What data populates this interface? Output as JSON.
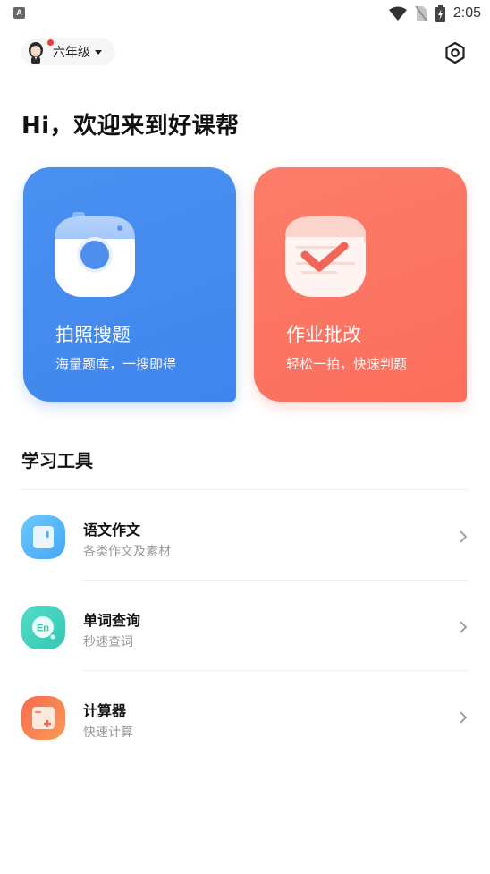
{
  "status_bar": {
    "left_icon": "A",
    "icons": [
      "wifi-icon",
      "no-sim-icon",
      "battery-charging-icon"
    ],
    "time": "2:05"
  },
  "header": {
    "grade": "六年级",
    "has_notification": true,
    "settings_icon": "settings-hexagon-icon"
  },
  "welcome": "Hi，欢迎来到好课帮",
  "features": [
    {
      "title": "拍照搜题",
      "subtitle": "海量题库，一搜即得",
      "icon": "camera-icon",
      "color": "#4388EF"
    },
    {
      "title": "作业批改",
      "subtitle": "轻松一拍，快速判题",
      "icon": "homework-check-icon",
      "color": "#FD725F"
    }
  ],
  "tools": {
    "title": "学习工具",
    "items": [
      {
        "title": "语文作文",
        "subtitle": "各类作文及素材",
        "icon": "notebook-icon",
        "color": "#56B6FA"
      },
      {
        "title": "单词查询",
        "subtitle": "秒速查词",
        "icon": "english-dictionary-icon",
        "color": "#41D2BE"
      },
      {
        "title": "计算器",
        "subtitle": "快速计算",
        "icon": "calculator-icon",
        "color": "#FB7A4E"
      }
    ]
  }
}
